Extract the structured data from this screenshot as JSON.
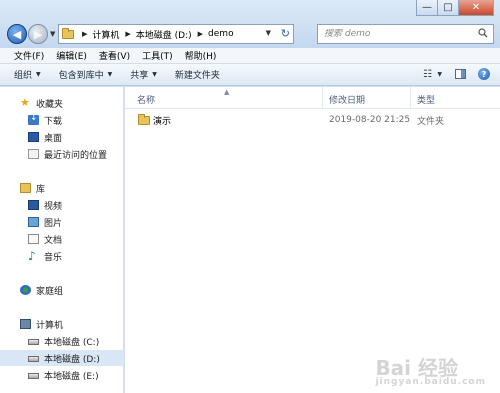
{
  "window": {
    "controls": {
      "minimize": "—",
      "maximize": "□",
      "close": "✕"
    }
  },
  "address": {
    "breadcrumbs": [
      "计算机",
      "本地磁盘 (D:)",
      "demo"
    ]
  },
  "search": {
    "placeholder": "搜索 demo"
  },
  "menubar": [
    "文件(F)",
    "编辑(E)",
    "查看(V)",
    "工具(T)",
    "帮助(H)"
  ],
  "commands": {
    "organize": "组织",
    "include_library": "包含到库中",
    "share": "共享",
    "new_folder": "新建文件夹"
  },
  "navpane": {
    "favorites": "收藏夹",
    "downloads": "下载",
    "desktop": "桌面",
    "recent": "最近访问的位置",
    "libraries": "库",
    "videos": "视频",
    "pictures": "图片",
    "documents": "文档",
    "music": "音乐",
    "homegroup": "家庭组",
    "computer": "计算机",
    "drive_c": "本地磁盘 (C:)",
    "drive_d": "本地磁盘 (D:)",
    "drive_e": "本地磁盘 (E:)"
  },
  "columns": {
    "name": "名称",
    "modified": "修改日期",
    "type": "类型"
  },
  "files": [
    {
      "name": "演示",
      "modified": "2019-08-20 21:25",
      "type": "文件夹"
    }
  ],
  "watermark": {
    "brand": "Bai 经验",
    "url": "jingyan.baidu.com"
  }
}
